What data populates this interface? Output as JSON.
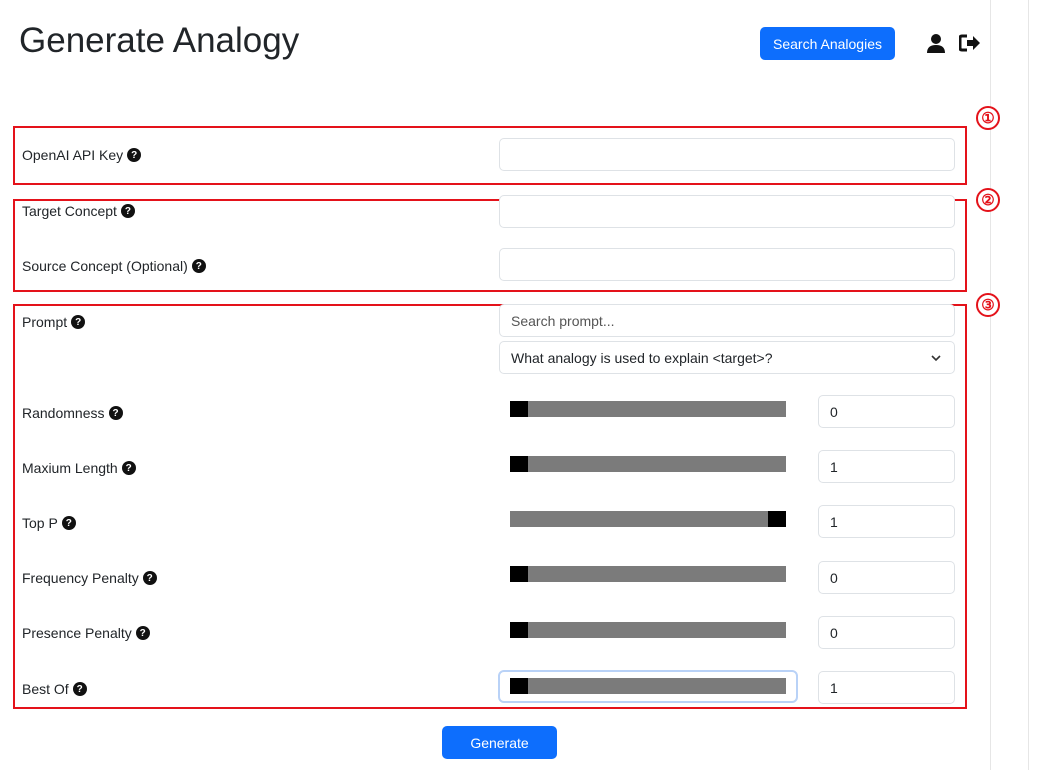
{
  "header": {
    "title": "Generate Analogy",
    "search_button": "Search Analogies",
    "user_icon": "user-icon",
    "logout_icon": "sign-out-icon"
  },
  "markers": [
    "①",
    "②",
    "③"
  ],
  "help_glyph": "?",
  "fields": {
    "api_key": {
      "label": "OpenAI API Key",
      "value": ""
    },
    "target_concept": {
      "label": "Target Concept",
      "value": ""
    },
    "source_concept": {
      "label": "Source Concept (Optional)",
      "value": ""
    },
    "prompt": {
      "label": "Prompt",
      "search_placeholder": "Search prompt...",
      "selected": "What analogy is used to explain <target>?"
    }
  },
  "sliders": [
    {
      "label": "Randomness",
      "value": "0",
      "position": 0
    },
    {
      "label": "Maxium Length",
      "value": "1",
      "position": 0
    },
    {
      "label": "Top P",
      "value": "1",
      "position": 1
    },
    {
      "label": "Frequency Penalty",
      "value": "0",
      "position": 0
    },
    {
      "label": "Presence Penalty",
      "value": "0",
      "position": 0
    },
    {
      "label": "Best Of",
      "value": "1",
      "position": 0
    }
  ],
  "generate_button": "Generate",
  "colors": {
    "primary": "#0d6efd",
    "annotation": "#e4121a",
    "slider_track": "#7b7b7b"
  }
}
